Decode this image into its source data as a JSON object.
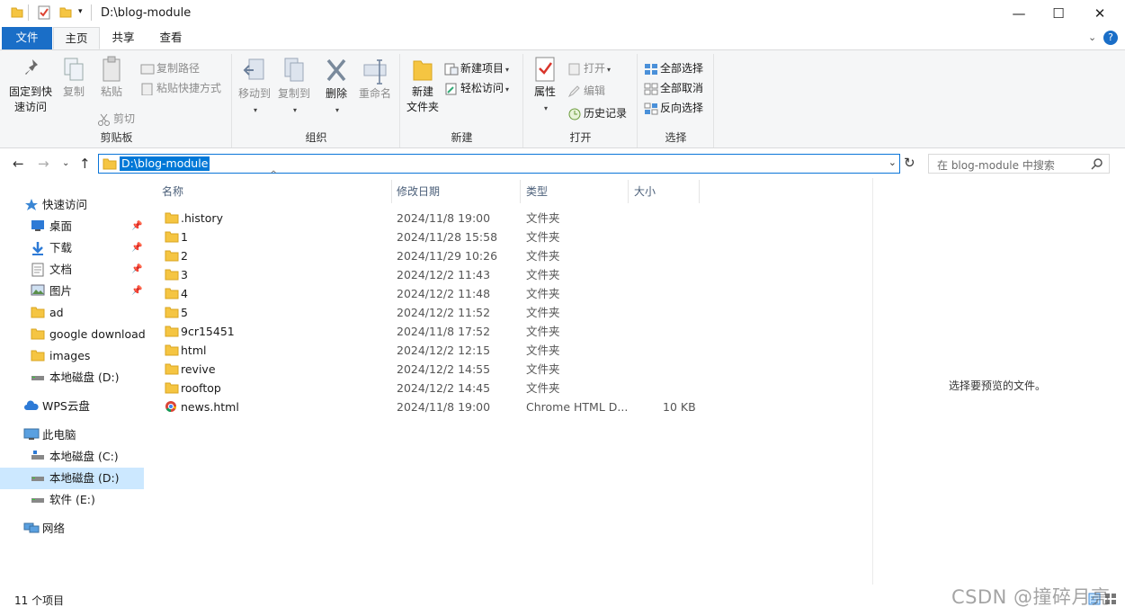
{
  "window": {
    "title": "D:\\blog-module"
  },
  "colors": {
    "accent": "#1a6ec7",
    "selection": "#0078d7",
    "folder": "#f5c542",
    "sidebar_selected": "#cce8ff"
  },
  "tabs": {
    "file": "文件",
    "home": "主页",
    "share": "共享",
    "view": "查看"
  },
  "ribbon": {
    "clipboard": {
      "label": "剪贴板",
      "pin": "固定到快\n速访问",
      "copy": "复制",
      "paste": "粘贴",
      "copy_path": "复制路径",
      "paste_shortcut": "粘贴快捷方式",
      "cut": "剪切"
    },
    "organize": {
      "label": "组织",
      "move_to": "移动到",
      "copy_to": "复制到",
      "delete": "删除",
      "rename": "重命名"
    },
    "new": {
      "label": "新建",
      "new_folder": "新建\n文件夹",
      "new_item": "新建项目",
      "easy_access": "轻松访问"
    },
    "open": {
      "label": "打开",
      "properties": "属性",
      "open": "打开",
      "edit": "编辑",
      "history": "历史记录"
    },
    "select": {
      "label": "选择",
      "select_all": "全部选择",
      "select_none": "全部取消",
      "invert": "反向选择"
    }
  },
  "address": {
    "path": "D:\\blog-module",
    "search_placeholder": "在 blog-module 中搜索"
  },
  "sidebar": {
    "quick_access": "快速访问",
    "items": [
      {
        "label": "桌面",
        "icon": "desktop-icon",
        "pinned": true
      },
      {
        "label": "下载",
        "icon": "download-icon",
        "pinned": true
      },
      {
        "label": "文档",
        "icon": "document-icon",
        "pinned": true
      },
      {
        "label": "图片",
        "icon": "picture-icon",
        "pinned": true
      },
      {
        "label": "ad",
        "icon": "folder-icon",
        "pinned": false
      },
      {
        "label": "google download",
        "icon": "folder-icon",
        "pinned": false
      },
      {
        "label": "images",
        "icon": "folder-icon",
        "pinned": false
      },
      {
        "label": "本地磁盘 (D:)",
        "icon": "drive-icon",
        "pinned": false
      }
    ],
    "wps": "WPS云盘",
    "this_pc": "此电脑",
    "drives": [
      {
        "label": "本地磁盘 (C:)",
        "icon": "system-drive-icon"
      },
      {
        "label": "本地磁盘 (D:)",
        "icon": "drive-icon"
      },
      {
        "label": "软件 (E:)",
        "icon": "drive-icon"
      }
    ],
    "network": "网络"
  },
  "columns": {
    "name": "名称",
    "date": "修改日期",
    "type": "类型",
    "size": "大小"
  },
  "files": [
    {
      "name": ".history",
      "date": "2024/11/8 19:00",
      "type": "文件夹",
      "size": "",
      "icon": "folder-icon"
    },
    {
      "name": "1",
      "date": "2024/11/28 15:58",
      "type": "文件夹",
      "size": "",
      "icon": "folder-icon"
    },
    {
      "name": "2",
      "date": "2024/11/29 10:26",
      "type": "文件夹",
      "size": "",
      "icon": "folder-icon"
    },
    {
      "name": "3",
      "date": "2024/12/2 11:43",
      "type": "文件夹",
      "size": "",
      "icon": "folder-icon"
    },
    {
      "name": "4",
      "date": "2024/12/2 11:48",
      "type": "文件夹",
      "size": "",
      "icon": "folder-icon"
    },
    {
      "name": "5",
      "date": "2024/12/2 11:52",
      "type": "文件夹",
      "size": "",
      "icon": "folder-icon"
    },
    {
      "name": "9cr15451",
      "date": "2024/11/8 17:52",
      "type": "文件夹",
      "size": "",
      "icon": "folder-icon"
    },
    {
      "name": "html",
      "date": "2024/12/2 12:15",
      "type": "文件夹",
      "size": "",
      "icon": "folder-icon"
    },
    {
      "name": "revive",
      "date": "2024/12/2 14:55",
      "type": "文件夹",
      "size": "",
      "icon": "folder-icon"
    },
    {
      "name": "rooftop",
      "date": "2024/12/2 14:45",
      "type": "文件夹",
      "size": "",
      "icon": "folder-icon"
    },
    {
      "name": "news.html",
      "date": "2024/11/8 19:00",
      "type": "Chrome HTML D...",
      "size": "10 KB",
      "icon": "chrome-icon"
    }
  ],
  "preview": {
    "message": "选择要预览的文件。"
  },
  "status": {
    "count": "11 个项目"
  },
  "watermark": "CSDN @撞碎月亮"
}
